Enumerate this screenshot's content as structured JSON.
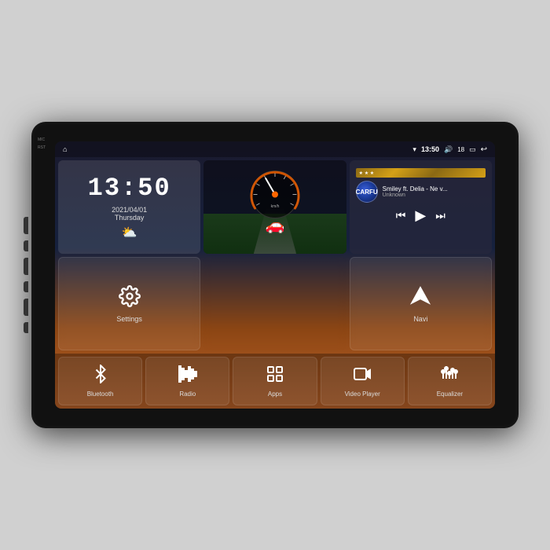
{
  "device": {
    "background": "#111"
  },
  "statusBar": {
    "time": "13:50",
    "volume": "18",
    "icons": {
      "wifi": "▾",
      "sound": "🔊",
      "battery": "🔋",
      "back": "↩",
      "home": "⌂"
    }
  },
  "clock": {
    "time": "13:50",
    "date": "2021/04/01",
    "day": "Thursday",
    "weatherIcon": "⛅"
  },
  "speedometer": {
    "speed": "km/h",
    "needleAngle": -30
  },
  "music": {
    "albumArt": "CARFU",
    "title": "Smiley ft. Delia - Ne v...",
    "artist": "Unknown",
    "controls": {
      "prev": "⏮",
      "play": "▶",
      "next": "⏭"
    }
  },
  "widgets": {
    "settings": {
      "label": "Settings",
      "icon": "⚙"
    },
    "navi": {
      "label": "Navi",
      "icon": "▲"
    }
  },
  "apps": [
    {
      "id": "bluetooth",
      "label": "Bluetooth"
    },
    {
      "id": "radio",
      "label": "Radio"
    },
    {
      "id": "apps",
      "label": "Apps"
    },
    {
      "id": "video",
      "label": "Video Player"
    },
    {
      "id": "equalizer",
      "label": "Equalizer"
    }
  ],
  "sideLabels": [
    "MIC",
    "RST"
  ]
}
